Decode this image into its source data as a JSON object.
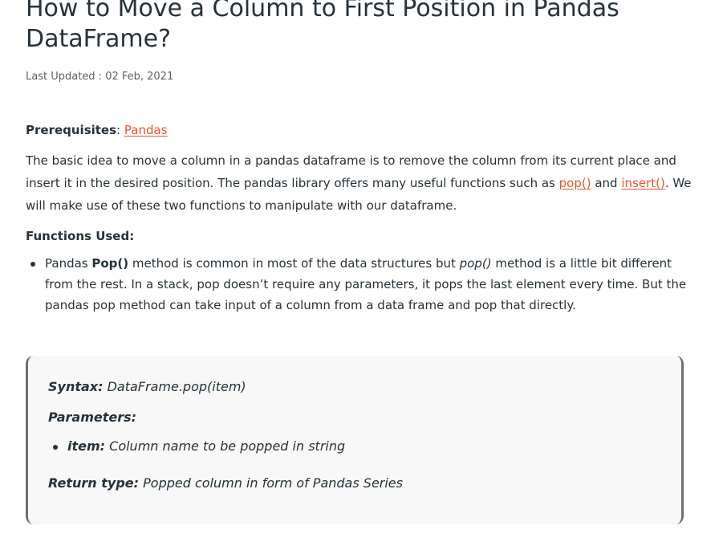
{
  "article": {
    "title": "How to Move a Column to First Position in Pandas DataFrame?",
    "last_updated": "Last Updated : 02 Feb, 2021",
    "prerequisites_label": "Prerequisites",
    "prerequisites_separator": ": ",
    "prerequisites_link": "Pandas",
    "description_part_1": "The basic idea to move a column in a pandas dataframe is to remove the column from its current place and insert it in the desired position. The pandas library offers many useful functions such as ",
    "pop_link": "pop()",
    "and_text": " and ",
    "insert_link": "insert()",
    "description_part_2": ". We will make use of these two functions to manipulate with our dataframe.",
    "functions_used_heading": "Functions Used:",
    "function_bullet": {
      "prefix": "Pandas ",
      "method_bold": "Pop()",
      "middle": " method is common in most of the data structures but ",
      "method_italic": "pop()",
      "suffix": " method is a little bit different from the rest. In a stack, pop doesn’t require any parameters, it pops the last element every time. But the pandas pop method can take input of a column from a data frame and pop that directly."
    }
  },
  "syntax_box": {
    "syntax_label": "Syntax:",
    "syntax_value": " DataFrame.pop(item)",
    "parameters_label": "Parameters:",
    "parameter_name": "item:",
    "parameter_description": " Column name to be popped in string",
    "return_type_label": "Return type:",
    "return_type_value": " Popped column in form of Pandas Series"
  },
  "colors": {
    "text": "#273239",
    "link": "#e8542f",
    "box_background": "#f8f8f8",
    "box_border": "#6f6f6f"
  }
}
